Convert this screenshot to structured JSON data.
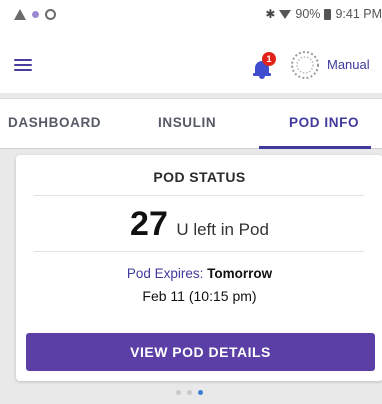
{
  "status_bar": {
    "battery": "90%",
    "time": "9:41 PM",
    "icons": [
      "warning-icon",
      "notification-dot-icon",
      "sync-ring-icon",
      "bluetooth-icon",
      "wifi-icon",
      "battery-icon"
    ]
  },
  "header": {
    "menu_icon": "hamburger-menu-icon",
    "notification_count": "1",
    "mode_label": "Manual"
  },
  "tabs": [
    {
      "label": "DASHBOARD",
      "active": false
    },
    {
      "label": "INSULIN",
      "active": false
    },
    {
      "label": "POD INFO",
      "active": true
    }
  ],
  "pod_status": {
    "title": "POD STATUS",
    "units": "27",
    "units_suffix": "U left in Pod",
    "expires_label": "Pod Expires:",
    "expires_value": "Tomorrow",
    "expires_date": "Feb 11 (10:15 pm)",
    "button_label": "VIEW POD DETAILS"
  },
  "pager": {
    "total": 3,
    "active_index": 2
  },
  "colors": {
    "accent": "#3f3a9c",
    "button": "#5b3fa6",
    "badge": "#e2231a",
    "bell": "#3f4ecf",
    "pager_active": "#3d7fd6"
  }
}
